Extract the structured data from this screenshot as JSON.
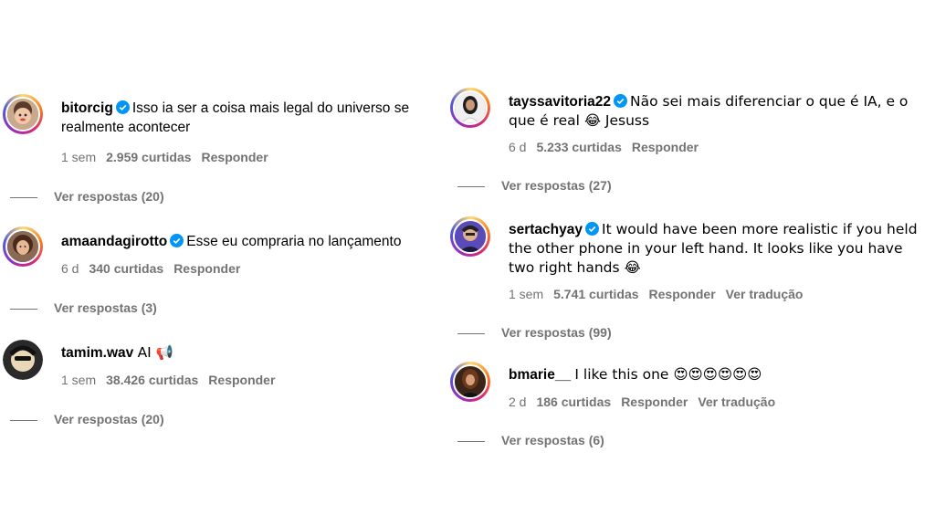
{
  "comments": [
    {
      "username": "bitorcig",
      "text": "Isso ia ser a coisa mais legal do universo se realmente acontecer",
      "time": "1 sem",
      "likes": "2.959 curtidas",
      "reply": "Responder",
      "translate": "",
      "replies": "Ver respostas (20)"
    },
    {
      "username": "amaandagirotto",
      "text": "Esse eu compraria no lançamento",
      "time": "6 d",
      "likes": "340 curtidas",
      "reply": "Responder",
      "translate": "",
      "replies": "Ver respostas (3)"
    },
    {
      "username": "tamim.wav",
      "text": "AI 📢",
      "time": "1 sem",
      "likes": "38.426 curtidas",
      "reply": "Responder",
      "translate": "",
      "replies": "Ver respostas (20)"
    },
    {
      "username": "tayssavitoria22",
      "text": "Não sei mais diferenciar o que é IA, e o que é real 😂 Jesuss",
      "time": "6 d",
      "likes": "5.233 curtidas",
      "reply": "Responder",
      "translate": "",
      "replies": "Ver respostas (27)"
    },
    {
      "username": "sertachyay",
      "text": "It would have been more realistic if you held the other phone in your left hand. It looks like you have two right hands 😂",
      "time": "1 sem",
      "likes": "5.741 curtidas",
      "reply": "Responder",
      "translate": "Ver tradução",
      "replies": "Ver respostas (99)"
    },
    {
      "username": "bmarie__",
      "text": "I like this one 😍😍😍😍😍😍",
      "time": "2 d",
      "likes": "186 curtidas",
      "reply": "Responder",
      "translate": "Ver tradução",
      "replies": "Ver respostas (6)"
    }
  ],
  "colors": {
    "verified": "#0095f6",
    "meta": "#737373"
  }
}
